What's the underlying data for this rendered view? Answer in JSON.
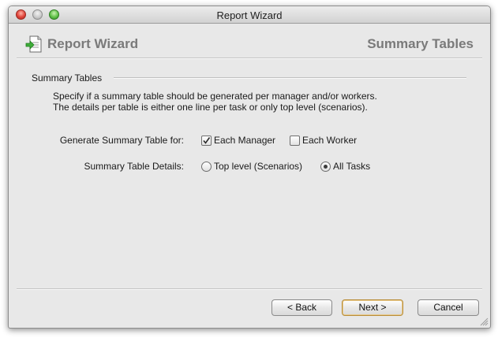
{
  "window": {
    "title": "Report Wizard"
  },
  "header": {
    "title": "Report Wizard",
    "step": "Summary Tables",
    "icon": "report-wizard-icon"
  },
  "section": {
    "title": "Summary Tables",
    "description_line1": "Specify if a summary table should be generated per manager and/or workers.",
    "description_line2": "The details per table is either one line per task or only top level (scenarios)."
  },
  "generate": {
    "label": "Generate Summary Table for:",
    "options": [
      {
        "label": "Each Manager",
        "checked": true
      },
      {
        "label": "Each Worker",
        "checked": false
      }
    ]
  },
  "details": {
    "label": "Summary Table Details:",
    "options": [
      {
        "label": "Top level (Scenarios)",
        "selected": false
      },
      {
        "label": "All Tasks",
        "selected": true
      }
    ]
  },
  "buttons": {
    "back": "<  Back",
    "next": "Next  >",
    "cancel": "Cancel"
  }
}
